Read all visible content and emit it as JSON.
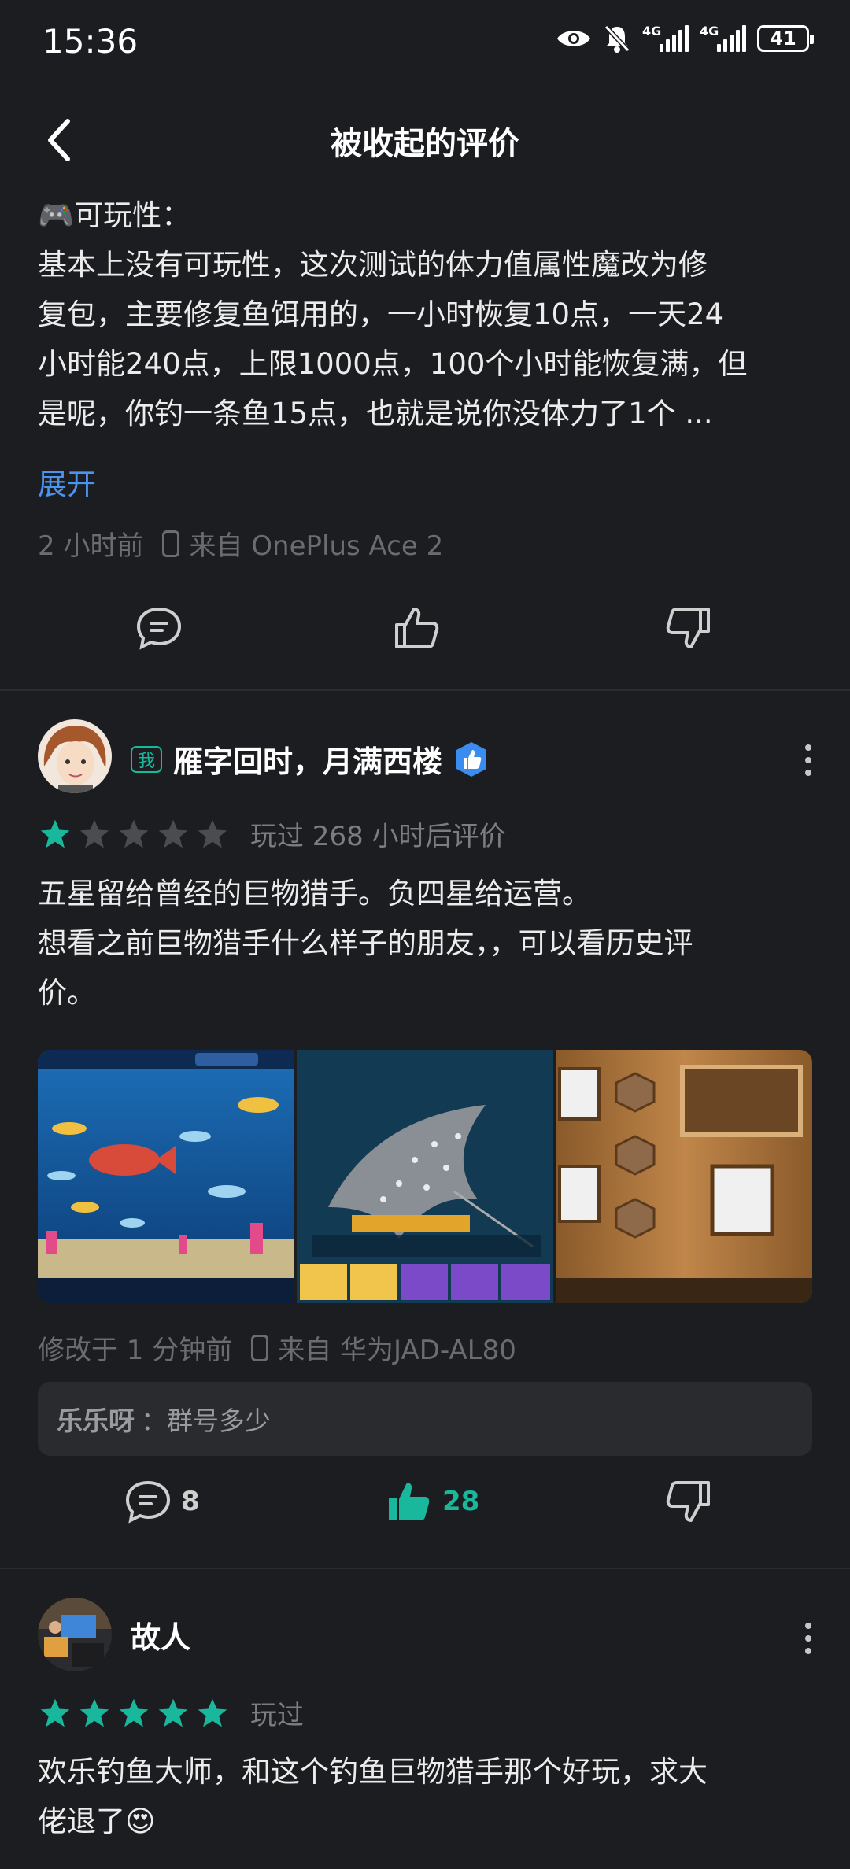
{
  "status_bar": {
    "time": "15:36",
    "network_1": "4G",
    "network_2": "4G",
    "battery": "41"
  },
  "header": {
    "title": "被收起的评价"
  },
  "review_partial": {
    "lines": [
      "🎮可玩性：",
      "基本上没有可玩性，这次测试的体力值属性魔改为修",
      "复包，主要修复鱼饵用的，一小时恢复10点，一天24",
      "小时能240点，上限1000点，100个小时能恢复满，但",
      "是呢，你钓一条鱼15点，也就是说你没体力了1个 ..."
    ],
    "expand_label": "展开",
    "time_ago": "2 小时前",
    "device": "来自 OnePlus Ace 2"
  },
  "review_1": {
    "badge": "我",
    "username": "雁字回时，月满西楼",
    "rating": 1,
    "max_rating": 5,
    "played_text": "玩过 268 小时后评价",
    "lines": [
      "五星留给曾经的巨物猎手。负四星给运营。",
      "想看之前巨物猎手什么样子的朋友，，可以看历史评",
      "价。"
    ],
    "images": [
      "aquarium-screenshot",
      "stingray-screenshot",
      "trophy-wall-screenshot"
    ],
    "time_ago": "修改于 1 分钟前",
    "device": "来自 华为JAD-AL80",
    "reply": {
      "author": "乐乐呀",
      "sep": "：",
      "text": "群号多少"
    },
    "comments": "8",
    "likes": "28",
    "accent": "#19b79c"
  },
  "review_2": {
    "username": "故人",
    "rating": 5,
    "max_rating": 5,
    "played_text": "玩过",
    "lines": [
      "欢乐钓鱼大师，和这个钓鱼巨物猎手那个好玩，求大",
      "佬退了😍"
    ]
  }
}
